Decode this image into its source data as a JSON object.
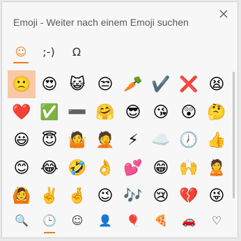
{
  "title": "Emoji - Weiter nach einem Emoji suchen",
  "tabs": [
    {
      "label": "☺",
      "name": "tab-emoji"
    },
    {
      "label": ";-)",
      "name": "tab-kaomoji"
    },
    {
      "label": "Ω",
      "name": "tab-symbols"
    }
  ],
  "emojis": [
    "🙁",
    "😍",
    "😺",
    "😒",
    "🥕",
    "✔️",
    "❌",
    "😫",
    "❤️",
    "✅",
    "➖",
    "🤗",
    "😎",
    "😘",
    "😲",
    "🤔",
    "😃",
    "😇",
    "🤷",
    "🤦",
    "⚡",
    "☁️",
    "🕖",
    "👍",
    "😊",
    "😂",
    "🤣",
    "👌",
    "💕",
    "😁",
    "🙌",
    "🙎",
    "🙆",
    "✌️",
    "🤞",
    "😉",
    "🎶",
    "😢",
    "💔",
    "😜"
  ],
  "categories": [
    {
      "icon": "🔍",
      "name": "category-search"
    },
    {
      "icon": "🕒",
      "name": "category-recent"
    },
    {
      "icon": "☺",
      "name": "category-smileys"
    },
    {
      "icon": "👤",
      "name": "category-people"
    },
    {
      "icon": "🎈",
      "name": "category-celebration"
    },
    {
      "icon": "🍕",
      "name": "category-food"
    },
    {
      "icon": "🚗",
      "name": "category-travel"
    },
    {
      "icon": "♡",
      "name": "category-symbols"
    }
  ],
  "colors": {
    "accent": "#f07a1e",
    "selected_bg": "#f7c9a6"
  }
}
